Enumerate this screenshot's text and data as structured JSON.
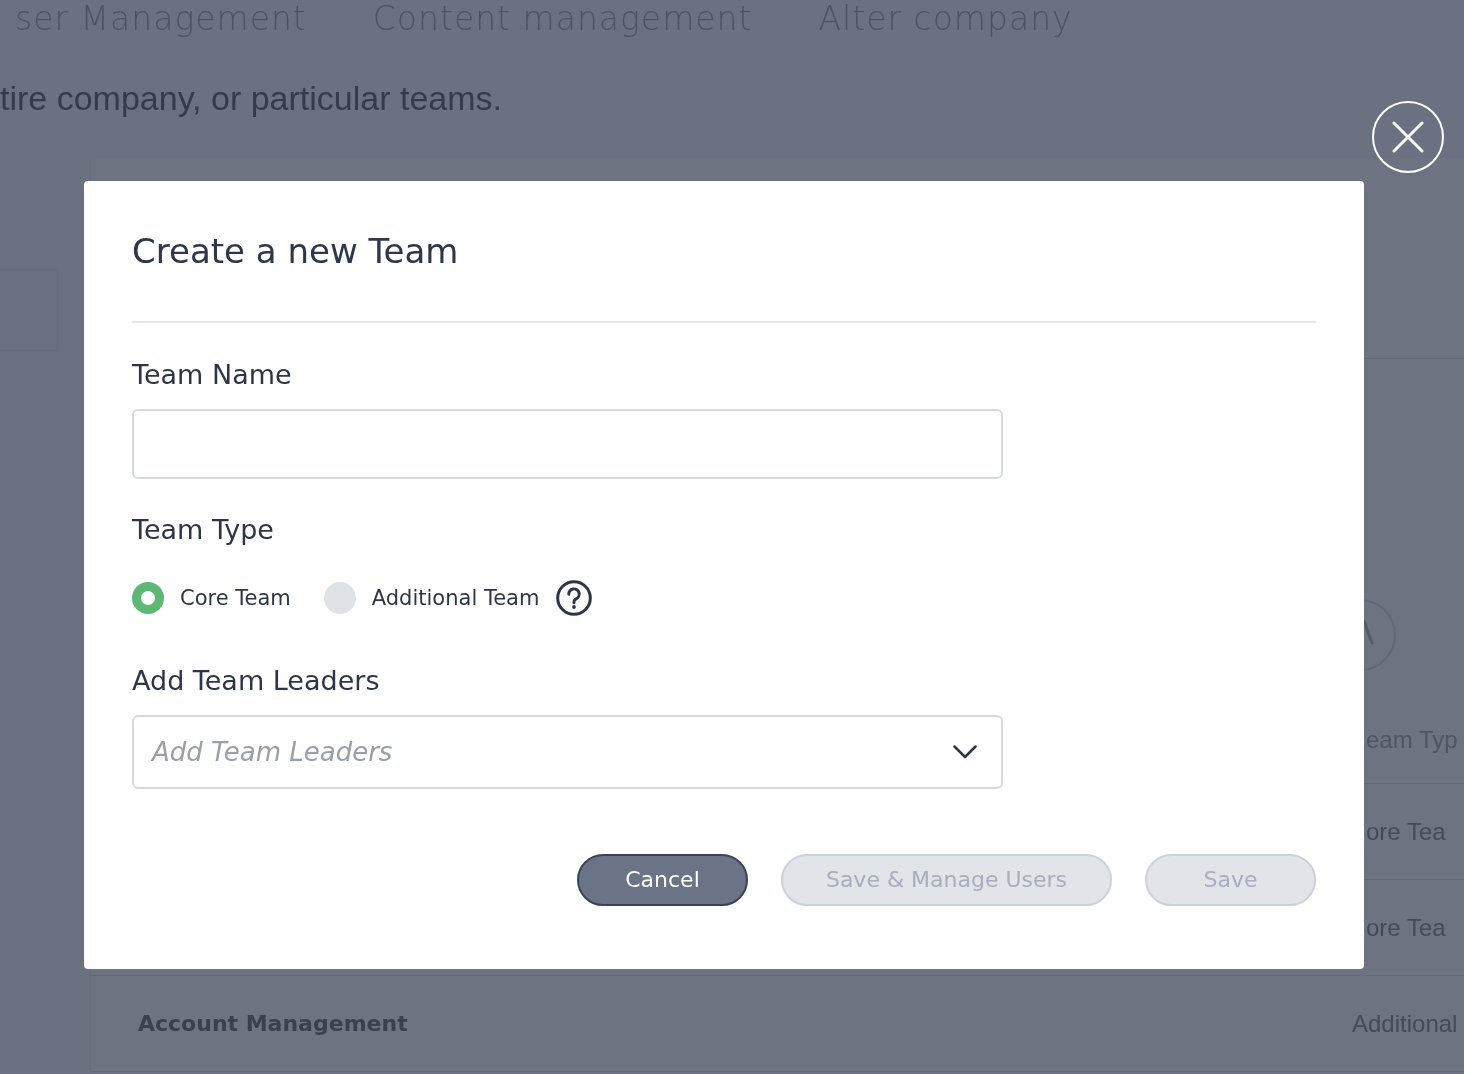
{
  "background": {
    "tabs": [
      {
        "label": "ser Management"
      },
      {
        "label": "Content management"
      },
      {
        "label": "Alter company"
      }
    ],
    "description": "tire company, or particular teams.",
    "table": {
      "header_2": "eam Typ",
      "rows": [
        {
          "column_2": "ore Tea"
        },
        {
          "column_2": "ore Tea"
        },
        {
          "column_1": "Account Management",
          "column_2": "Additional"
        }
      ]
    }
  },
  "modal": {
    "title": "Create a new Team",
    "fields": [
      {
        "kind": "text",
        "label": "Team Name"
      },
      {
        "kind": "radio",
        "label": "Team Type",
        "options": [
          {
            "label": "Core Team",
            "selected": true
          },
          {
            "label": "Additional Team",
            "selected": false
          }
        ],
        "help": true
      },
      {
        "kind": "select",
        "label": "Add Team Leaders",
        "placeholder": "Add Team Leaders"
      }
    ],
    "buttons": [
      {
        "label": "Cancel",
        "disabled": false
      },
      {
        "label": "Save & Manage Users",
        "disabled": true
      },
      {
        "label": "Save",
        "disabled": true
      }
    ]
  }
}
